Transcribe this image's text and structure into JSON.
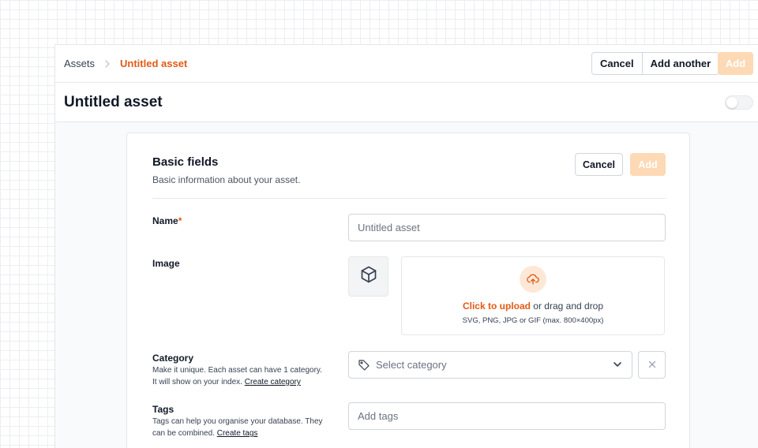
{
  "breadcrumb": {
    "root": "Assets",
    "current": "Untitled asset"
  },
  "top_actions": {
    "cancel_label": "Cancel",
    "add_another_label": "Add another",
    "add_label": "Add"
  },
  "page": {
    "title": "Untitled asset",
    "toggle_on": false
  },
  "section": {
    "title": "Basic fields",
    "subtitle": "Basic information about your asset.",
    "cancel_label": "Cancel",
    "add_label": "Add"
  },
  "fields": {
    "name": {
      "label": "Name",
      "required_mark": "*",
      "placeholder": "Untitled asset"
    },
    "image": {
      "label": "Image",
      "upload_link": "Click to upload",
      "upload_rest": " or drag and drop",
      "upload_hint": "SVG, PNG, JPG or GIF (max. 800×400px)"
    },
    "category": {
      "label": "Category",
      "help_line1": "Make it unique. Each asset can have 1 category.",
      "help_line2": "It will show on your index.",
      "help_link": "Create category",
      "placeholder": "Select category"
    },
    "tags": {
      "label": "Tags",
      "help_line1": "Tags can help you organise your database. They",
      "help_line2": "can be combined.",
      "help_link": "Create tags",
      "placeholder": "Add tags"
    }
  },
  "colors": {
    "accent": "#e35a14",
    "accent_disabled": "#fdd9b5",
    "border": "#d1d5db"
  },
  "icons": {
    "breadcrumb_separator": "chevron-right-icon",
    "image_placeholder": "cube-icon",
    "upload": "upload-cloud-icon",
    "category": "tag-icon",
    "dropdown": "chevron-down-icon",
    "clear": "close-icon"
  }
}
